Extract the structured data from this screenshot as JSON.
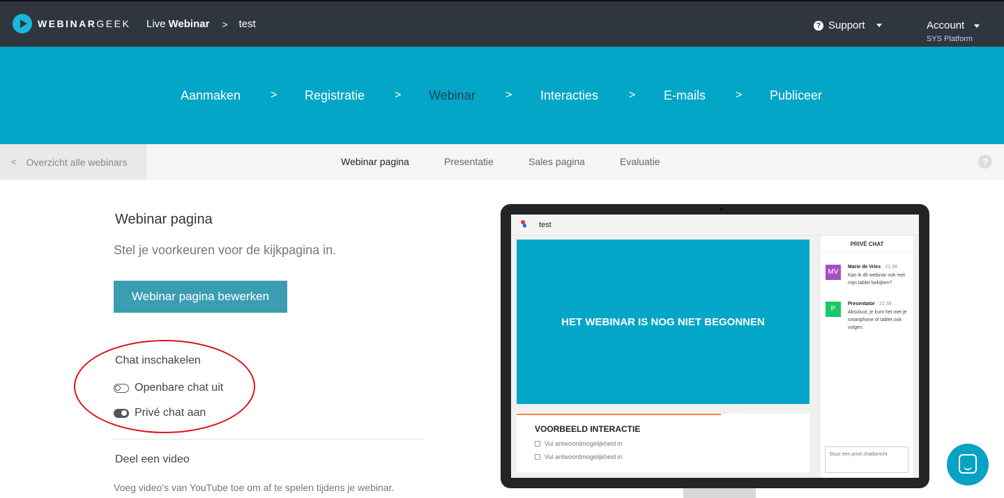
{
  "topbar": {
    "logo_bold": "WEBINAR",
    "logo_light": "GEEK",
    "crumb_prefix": "Live",
    "crumb_bold": "Webinar",
    "crumb_chevron": ">",
    "crumb_current": "test",
    "support_icon": "?",
    "support_label": "Support",
    "account_label": "Account",
    "account_sub": "SYS Platform"
  },
  "steps": {
    "items": [
      "Aanmaken",
      "Registratie",
      "Webinar",
      "Interacties",
      "E-mails",
      "Publiceer"
    ],
    "active": "Webinar",
    "separator": ">"
  },
  "subnav": {
    "back_chevron": "<",
    "back_label": "Overzicht alle webinars",
    "tabs": [
      "Webinar pagina",
      "Presentatie",
      "Sales pagina",
      "Evaluatie"
    ],
    "active": "Webinar pagina",
    "help_icon": "?"
  },
  "main": {
    "title": "Webinar pagina",
    "subtitle": "Stel je voorkeuren voor de kijkpagina in.",
    "edit_button": "Webinar pagina bewerken",
    "chat_label": "Chat inschakelen",
    "public_chat": "Openbare chat uit",
    "public_chat_on": false,
    "private_chat": "Privé chat aan",
    "private_chat_on": true,
    "video_label": "Deel een video",
    "video_desc": "Voeg video's van YouTube toe om af te spelen tijdens je webinar."
  },
  "preview": {
    "title": "test",
    "video_text": "HET WEBINAR IS NOG NIET BEGONNEN",
    "interaction_title": "VOORBEELD INTERACTIE",
    "options": [
      "Vul antwoordmogelijkheid in",
      "Vul antwoordmogelijkheid in"
    ],
    "chat_header": "PRIVÉ CHAT",
    "messages": [
      {
        "initials": "MV",
        "name": "Marie de Vries",
        "time": "· 21:38",
        "text": "Kan ik dit webinar ook met mijn tablet bekijken?",
        "color": "#a84ec4"
      },
      {
        "initials": "P",
        "name": "Presentator",
        "time": "· 21:39",
        "text": "Absoluut, je kunt het met je smartphone of tablet ook volgen.",
        "color": "#17c964"
      }
    ],
    "chat_placeholder": "Stuur een privé chatbericht"
  },
  "colors": {
    "topbar": "#2f3640",
    "accent": "#03a6c6",
    "button": "#3b9db2",
    "highlight": "#e0101a"
  }
}
